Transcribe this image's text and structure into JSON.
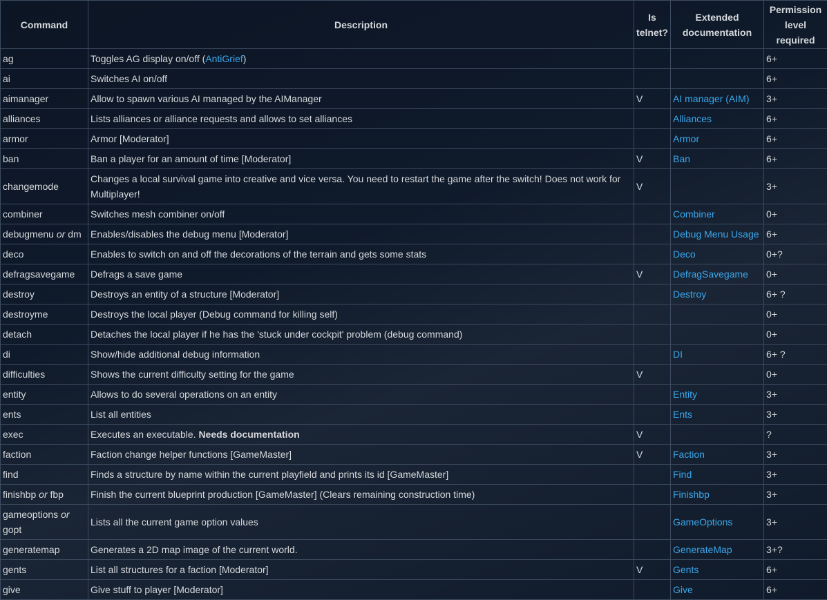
{
  "colors": {
    "link": "#3aa8ec",
    "text": "#d6d9dc"
  },
  "headers": [
    "Command",
    "Description",
    "Is telnet?",
    "Extended documentation",
    "Permission level required"
  ],
  "rows": [
    {
      "cmd": "ag",
      "desc": "Toggles AG display on/off (",
      "desc_link": "AntiGrief",
      "desc_after": ")",
      "telnet": "",
      "doc": "",
      "perm": "6+"
    },
    {
      "cmd": "ai",
      "desc": "Switches AI on/off",
      "telnet": "",
      "doc": "",
      "perm": "6+"
    },
    {
      "cmd": "aimanager",
      "desc": "Allow to spawn various AI managed by the AIManager",
      "telnet": "V",
      "doc": "AI manager (AIM)",
      "perm": "3+"
    },
    {
      "cmd": "alliances",
      "desc": "Lists alliances or alliance requests and allows to set alliances",
      "telnet": "",
      "doc": "Alliances",
      "perm": "6+"
    },
    {
      "cmd": "armor",
      "desc": "Armor [Moderator]",
      "telnet": "",
      "doc": "Armor",
      "perm": "6+"
    },
    {
      "cmd": "ban",
      "desc": "Ban a player for an amount of time [Moderator]",
      "telnet": "V",
      "doc": "Ban",
      "perm": "6+"
    },
    {
      "cmd": "changemode",
      "desc": "Changes a local survival game into creative and vice versa. You need to restart the game after the switch! Does not work for Multiplayer!",
      "telnet": "V",
      "doc": "",
      "perm": "3+",
      "tall": true
    },
    {
      "cmd": "combiner",
      "desc": "Switches mesh combiner on/off",
      "telnet": "",
      "doc": "Combiner",
      "perm": "0+"
    },
    {
      "cmd": "debugmenu",
      "cmd_or": "or",
      "cmd_alt": "dm",
      "desc": "Enables/disables the debug menu [Moderator]",
      "telnet": "",
      "doc": "Debug Menu Usage",
      "perm": "6+"
    },
    {
      "cmd": "deco",
      "desc": "Enables to switch on and off the decorations of the terrain and gets some stats",
      "telnet": "",
      "doc": "Deco",
      "perm": "0+?"
    },
    {
      "cmd": "defragsavegame",
      "desc": "Defrags a save game",
      "telnet": "V",
      "doc": "DefragSavegame",
      "perm": "0+"
    },
    {
      "cmd": "destroy",
      "desc": "Destroys an entity of a structure [Moderator]",
      "telnet": "",
      "doc": "Destroy",
      "perm": "6+ ?"
    },
    {
      "cmd": "destroyme",
      "desc": "Destroys the local player (Debug command for killing self)",
      "telnet": "",
      "doc": "",
      "perm": "0+"
    },
    {
      "cmd": "detach",
      "desc": "Detaches the local player if he has the 'stuck under cockpit' problem (debug command)",
      "telnet": "",
      "doc": "",
      "perm": "0+"
    },
    {
      "cmd": "di",
      "desc": "Show/hide additional debug information",
      "telnet": "",
      "doc": "DI",
      "perm": "6+ ?"
    },
    {
      "cmd": "difficulties",
      "desc": "Shows the current difficulty setting for the game",
      "telnet": "V",
      "doc": "",
      "perm": "0+"
    },
    {
      "cmd": "entity",
      "desc": "Allows to do several operations on an entity",
      "telnet": "",
      "doc": "Entity",
      "perm": "3+"
    },
    {
      "cmd": "ents",
      "desc": "List all entities",
      "telnet": "",
      "doc": "Ents",
      "perm": "3+"
    },
    {
      "cmd": "exec",
      "desc": "Executes an executable. ",
      "desc_bold": "Needs documentation",
      "telnet": "V",
      "doc": "",
      "perm": "?"
    },
    {
      "cmd": "faction",
      "desc": "Faction change helper functions [GameMaster]",
      "telnet": "V",
      "doc": "Faction",
      "perm": "3+"
    },
    {
      "cmd": "find",
      "desc": "Finds a structure by name within the current playfield and prints its id [GameMaster]",
      "telnet": "",
      "doc": "Find",
      "perm": "3+"
    },
    {
      "cmd": "finishbp",
      "cmd_or": "or",
      "cmd_alt": "fbp",
      "desc": "Finish the current blueprint production [GameMaster] (Clears remaining construction time)",
      "telnet": "",
      "doc": "Finishbp",
      "perm": "3+"
    },
    {
      "cmd": "gameoptions",
      "cmd_or": "or",
      "cmd_alt": "gopt",
      "desc": "Lists all the current game option values",
      "telnet": "",
      "doc": "GameOptions",
      "perm": "3+",
      "tall": true
    },
    {
      "cmd": "generatemap",
      "desc": "Generates a 2D map image of the current world.",
      "telnet": "",
      "doc": "GenerateMap",
      "perm": "3+?"
    },
    {
      "cmd": "gents",
      "desc": "List all structures for a faction [Moderator]",
      "telnet": "V",
      "doc": "Gents",
      "perm": "6+"
    },
    {
      "cmd": "give",
      "desc": "Give stuff to player [Moderator]",
      "telnet": "",
      "doc": "Give",
      "perm": "6+"
    }
  ]
}
